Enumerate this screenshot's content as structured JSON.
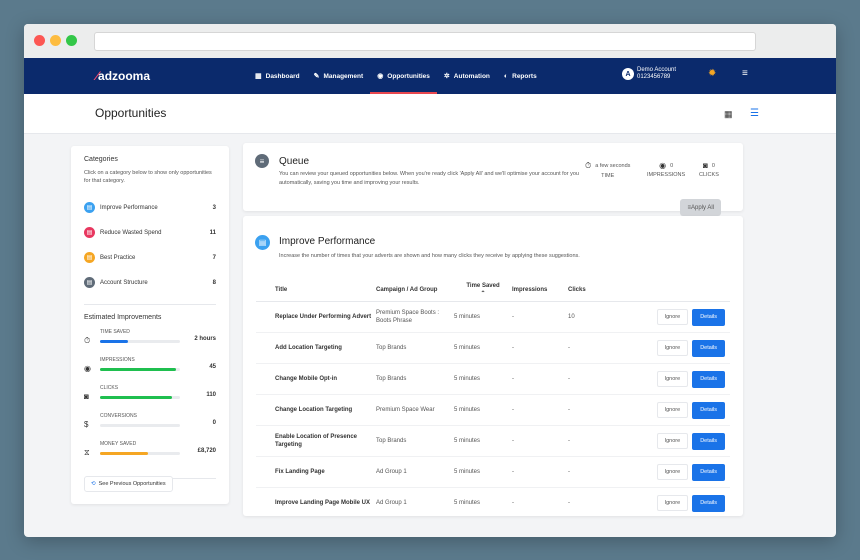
{
  "browser": {
    "controls": [
      "close",
      "minimize",
      "maximize"
    ]
  },
  "nav": {
    "logo": "adzooma",
    "items": [
      {
        "label": "Dashboard",
        "icon": "grid-icon"
      },
      {
        "label": "Management",
        "icon": "wrench-icon"
      },
      {
        "label": "Opportunities",
        "icon": "target-icon",
        "active": true
      },
      {
        "label": "Automation",
        "icon": "gear-icon"
      },
      {
        "label": "Reports",
        "icon": "chart-icon"
      }
    ],
    "account_initial": "A",
    "account_name": "Demo Account",
    "account_id": "0123456789"
  },
  "page": {
    "title": "Opportunities"
  },
  "sidebar": {
    "categories_title": "Categories",
    "categories_desc": "Click on a category below to show only opportunities for that category.",
    "categories": [
      {
        "label": "Improve Performance",
        "count": "3",
        "color": "#3ba1f0"
      },
      {
        "label": "Reduce Wasted Spend",
        "count": "11",
        "color": "#e8375f"
      },
      {
        "label": "Best Practice",
        "count": "7",
        "color": "#f5a623"
      },
      {
        "label": "Account Structure",
        "count": "8",
        "color": "#5f6b78"
      }
    ],
    "estimated_title": "Estimated Improvements",
    "estimates": [
      {
        "label": "TIME SAVED",
        "value": "2 hours",
        "fill": 0.35,
        "color": "#1a73e8",
        "icon": "stopwatch-icon"
      },
      {
        "label": "IMPRESSIONS",
        "value": "45",
        "fill": 0.95,
        "color": "#1fbf4f",
        "icon": "eye-icon"
      },
      {
        "label": "CLICKS",
        "value": "110",
        "fill": 0.9,
        "color": "#1fbf4f",
        "icon": "mouse-icon"
      },
      {
        "label": "CONVERSIONS",
        "value": "0",
        "fill": 0.0,
        "color": "#1fbf4f",
        "icon": "dollar-icon"
      },
      {
        "label": "MONEY SAVED",
        "value": "£8,720",
        "fill": 0.6,
        "color": "#f5a623",
        "icon": "money-off-icon"
      }
    ],
    "see_previous": "See Previous Opportunities"
  },
  "queue": {
    "title": "Queue",
    "desc": "You can review your queued opportunities below. When you're ready click 'Apply All' and we'll optimise your account for you automatically, saving you time and improving your results.",
    "stats": [
      {
        "value": "a few seconds",
        "label": "TIME",
        "icon": "stopwatch-icon"
      },
      {
        "value": "0",
        "label": "IMPRESSIONS",
        "icon": "eye-icon"
      },
      {
        "value": "0",
        "label": "CLICKS",
        "icon": "mouse-icon"
      }
    ],
    "apply_all": "Apply All"
  },
  "improve": {
    "title": "Improve Performance",
    "desc": "Increase the number of times that your adverts are shown and how many clicks they receive by applying these suggestions.",
    "columns": {
      "title": "Title",
      "campaign": "Campaign / Ad Group",
      "time": "Time Saved",
      "impressions": "Impressions",
      "clicks": "Clicks"
    },
    "ignore": "Ignore",
    "details": "Details",
    "rows": [
      {
        "title": "Replace Under Performing Advert",
        "campaign": "Premium Space Boots : Boots Phrase",
        "time": "5 minutes",
        "impressions": "-",
        "clicks": "10"
      },
      {
        "title": "Add Location Targeting",
        "campaign": "Top Brands",
        "time": "5 minutes",
        "impressions": "-",
        "clicks": "-"
      },
      {
        "title": "Change Mobile Opt-in",
        "campaign": "Top Brands",
        "time": "5 minutes",
        "impressions": "-",
        "clicks": "-"
      },
      {
        "title": "Change Location Targeting",
        "campaign": "Premium Space Wear",
        "time": "5 minutes",
        "impressions": "-",
        "clicks": "-"
      },
      {
        "title": "Enable Location of Presence Targeting",
        "campaign": "Top Brands",
        "time": "5 minutes",
        "impressions": "-",
        "clicks": "-"
      },
      {
        "title": "Fix Landing Page",
        "campaign": "Ad Group 1",
        "time": "5 minutes",
        "impressions": "-",
        "clicks": "-"
      },
      {
        "title": "Improve Landing Page Mobile UX",
        "campaign": "Ad Group 1",
        "time": "5 minutes",
        "impressions": "-",
        "clicks": "-"
      }
    ]
  }
}
